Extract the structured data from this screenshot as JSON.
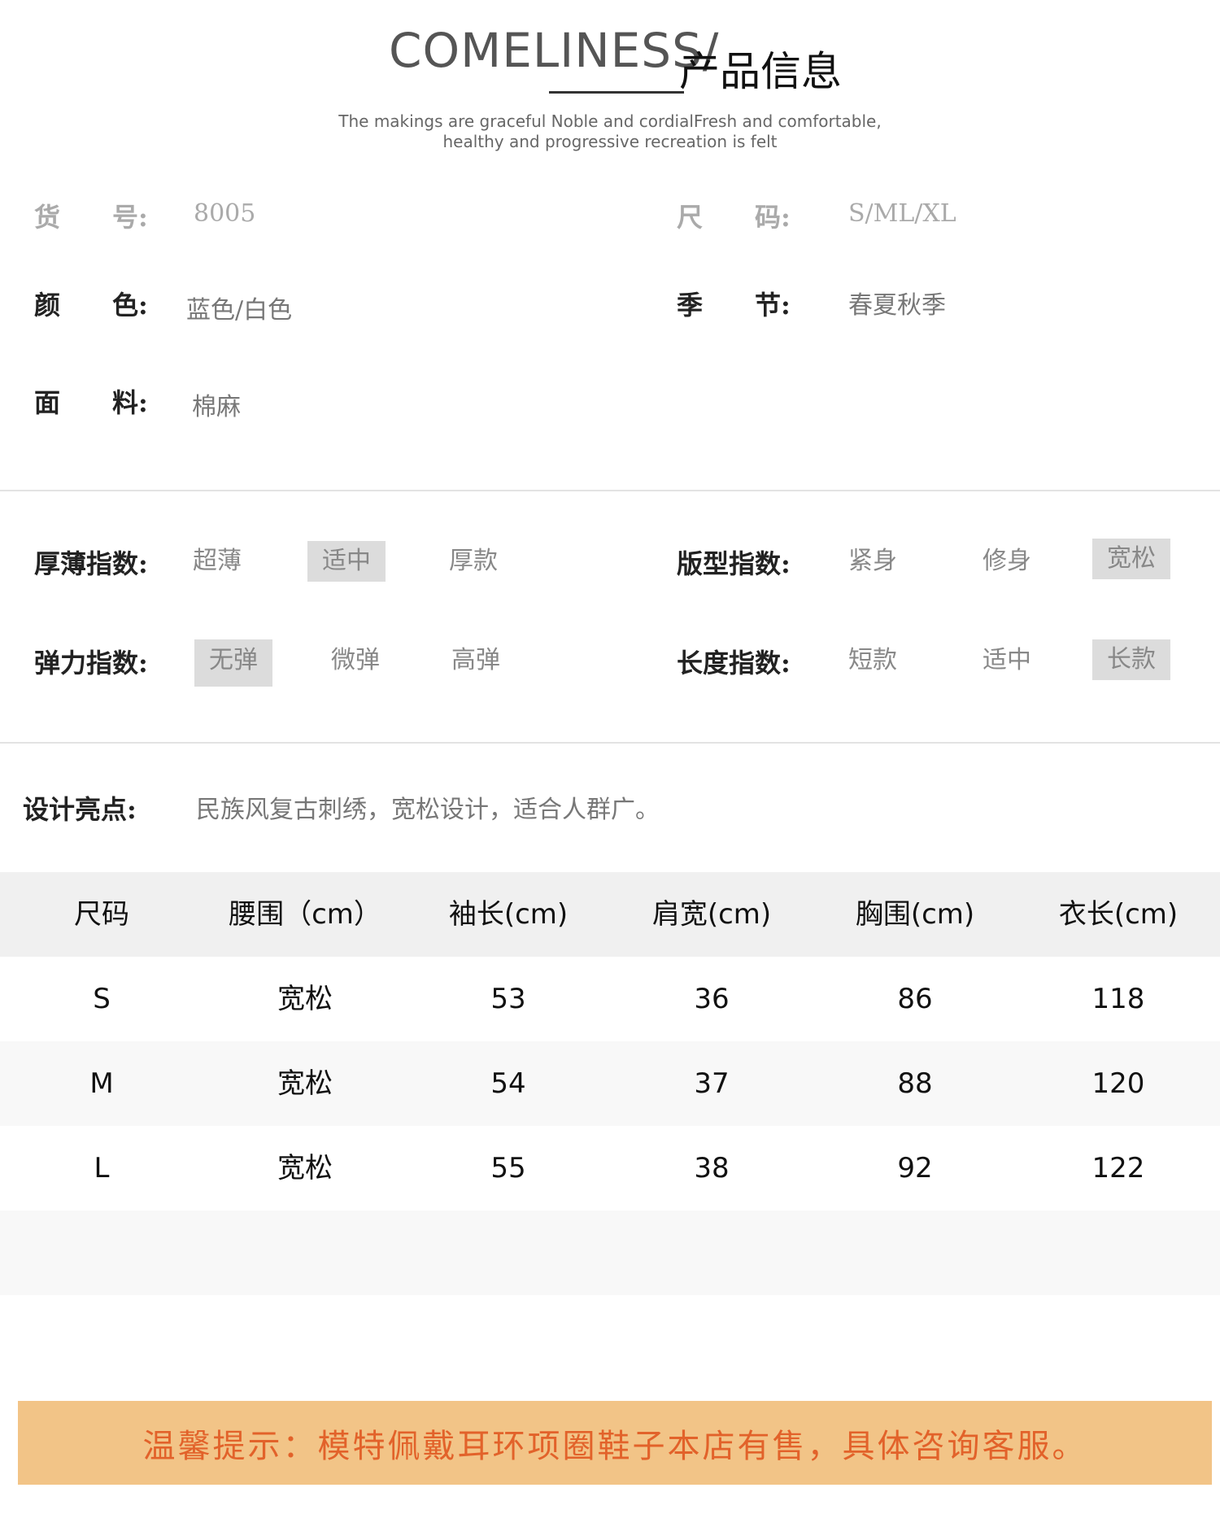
{
  "header": {
    "title_en": "COMELINESS/",
    "title_cn": "产品信息",
    "tagline_line1": "The makings are graceful Noble and cordialFresh and comfortable,",
    "tagline_line2": "healthy and progressive recreation is felt"
  },
  "info": {
    "item_no": {
      "label": "货　　号:",
      "value": "8005"
    },
    "size": {
      "label": "尺　　码:",
      "value": "S/ML/XL"
    },
    "color": {
      "label": "颜　　色:",
      "value": "蓝色/白色"
    },
    "season": {
      "label": "季　　节:",
      "value": "春夏秋季"
    },
    "fabric": {
      "label": "面　　料:",
      "value": "棉麻"
    }
  },
  "indices": {
    "thickness": {
      "label": "厚薄指数:",
      "options": [
        "超薄",
        "适中",
        "厚款"
      ],
      "selected": "适中"
    },
    "fit": {
      "label": "版型指数:",
      "options": [
        "紧身",
        "修身",
        "宽松"
      ],
      "selected": "宽松"
    },
    "elasticity": {
      "label": "弹力指数:",
      "options": [
        "无弹",
        "微弹",
        "高弹"
      ],
      "selected": "无弹"
    },
    "length": {
      "label": "长度指数:",
      "options": [
        "短款",
        "适中",
        "长款"
      ],
      "selected": "长款"
    }
  },
  "design": {
    "label": "设计亮点:",
    "value": "民族风复古刺绣，宽松设计，适合人群广。"
  },
  "size_table": {
    "headers": [
      "尺码",
      "腰围（cm）",
      "袖长(cm)",
      "肩宽(cm)",
      "胸围(cm)",
      "衣长(cm)"
    ],
    "rows": [
      [
        "S",
        "宽松",
        "53",
        "36",
        "86",
        "118"
      ],
      [
        "M",
        "宽松",
        "54",
        "37",
        "88",
        "120"
      ],
      [
        "L",
        "宽松",
        "55",
        "38",
        "92",
        "122"
      ]
    ]
  },
  "notice": {
    "text": "温馨提示：模特佩戴耳环项圈鞋子本店有售，具体咨询客服。"
  },
  "colors": {
    "notice_bg": "#f2c487",
    "notice_text": "#e2622a",
    "selected_option_bg": "#dcdcdc",
    "table_header_bg": "#f0f0f0"
  }
}
